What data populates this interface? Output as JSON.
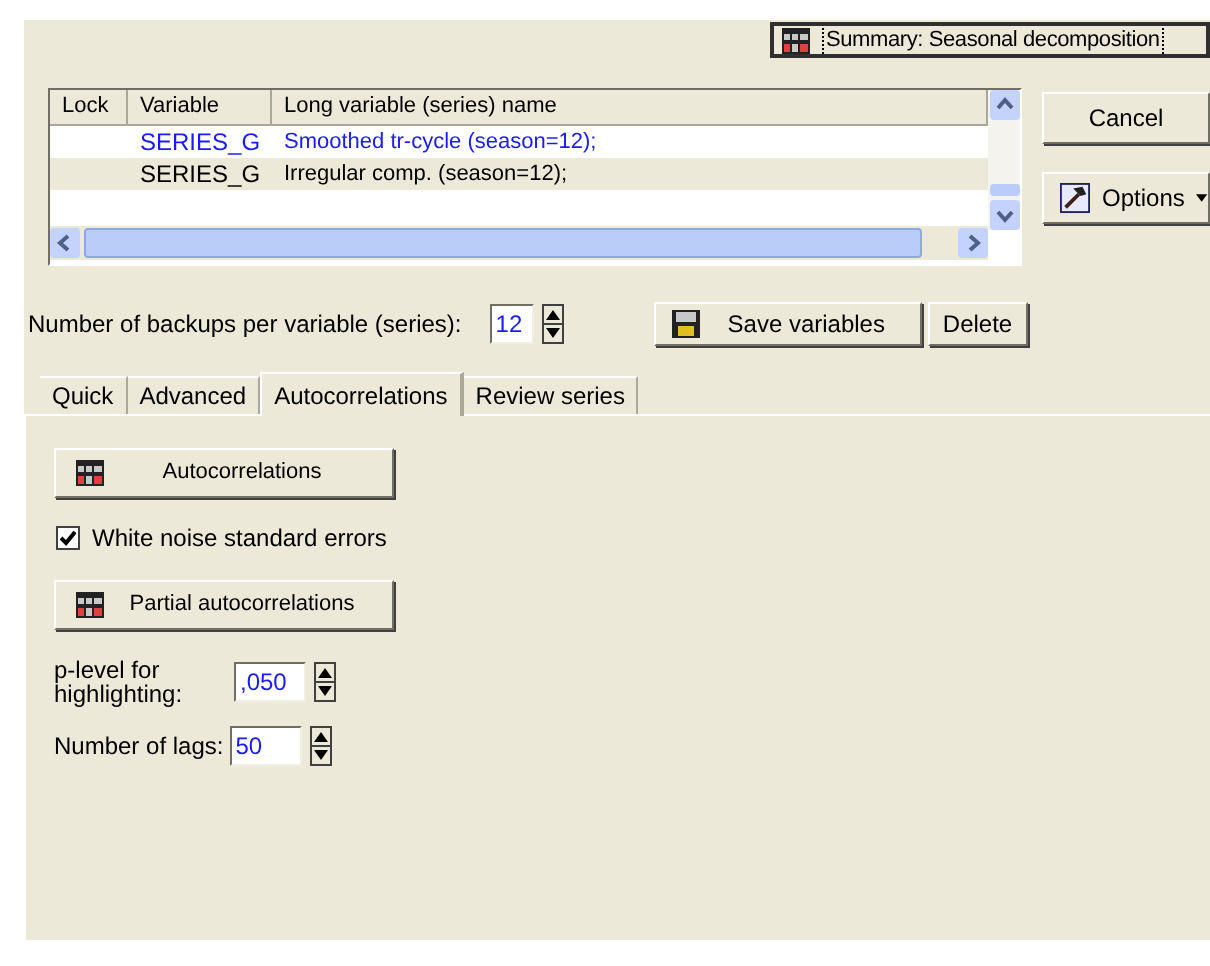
{
  "summary_button": {
    "label": "Summary:  Seasonal decomposition"
  },
  "variables_table": {
    "columns": [
      "Lock",
      "Variable",
      "Long variable (series) name"
    ],
    "rows": [
      {
        "variable": "SERIES_G",
        "long_name": "Smoothed tr-cycle (season=12);",
        "selected": true
      },
      {
        "variable": "SERIES_G",
        "long_name": "Irregular comp. (season=12);",
        "selected": false
      }
    ]
  },
  "side_buttons": [
    {
      "label": "Cancel",
      "kind": "plain"
    },
    {
      "label": "Options",
      "kind": "menu"
    }
  ],
  "backups": {
    "label": "Number of backups per variable (series):",
    "value": "12"
  },
  "save_button": {
    "label": "Save variables"
  },
  "delete_button": {
    "label": "Delete"
  },
  "tabs": [
    {
      "label": "Quick",
      "selected": false
    },
    {
      "label": "Advanced",
      "selected": false
    },
    {
      "label": "Autocorrelations",
      "selected": true
    },
    {
      "label": "Review series",
      "selected": false
    }
  ],
  "panel": {
    "autocorrelations_button": {
      "label": "Autocorrelations"
    },
    "white_noise": {
      "label": "White noise standard errors",
      "checked": true
    },
    "partial_button": {
      "label": "Partial autocorrelations"
    },
    "p_level": {
      "label": "p-level for highlighting:",
      "value": ",050"
    },
    "lags": {
      "label": "Number of lags:",
      "value": "50"
    }
  }
}
